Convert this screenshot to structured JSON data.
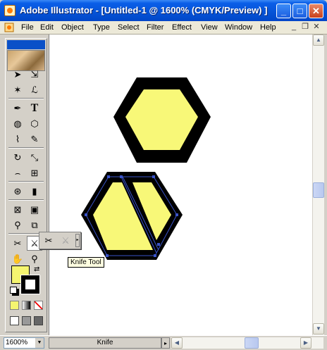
{
  "window": {
    "title": "Adobe Illustrator - [Untitled-1 @ 1600% (CMYK/Preview) ]",
    "minimize_label": "_",
    "maximize_label": "□",
    "close_label": "✕"
  },
  "menubar": {
    "items": [
      "File",
      "Edit",
      "Object",
      "Type",
      "Select",
      "Filter",
      "Effect",
      "View",
      "Window",
      "Help"
    ],
    "mdi_minimize": "_",
    "mdi_restore": "❐",
    "mdi_close": "✕"
  },
  "toolbox": {
    "tools": [
      {
        "name": "selection-tool-icon",
        "glyph": "➤"
      },
      {
        "name": "direct-selection-tool-icon",
        "glyph": "⇲"
      },
      {
        "name": "magic-wand-tool-icon",
        "glyph": "✶"
      },
      {
        "name": "lasso-tool-icon",
        "glyph": "ℒ"
      },
      {
        "name": "pen-tool-icon",
        "glyph": "✒"
      },
      {
        "name": "type-tool-icon",
        "glyph": "T"
      },
      {
        "name": "ellipse-tool-icon",
        "glyph": "◍"
      },
      {
        "name": "polygon-tool-icon",
        "glyph": "⬡"
      },
      {
        "name": "paintbrush-tool-icon",
        "glyph": "⌇"
      },
      {
        "name": "pencil-tool-icon",
        "glyph": "✎"
      },
      {
        "name": "rotate-tool-icon",
        "glyph": "↻"
      },
      {
        "name": "scale-tool-icon",
        "glyph": "⤡"
      },
      {
        "name": "warp-tool-icon",
        "glyph": "⌢"
      },
      {
        "name": "free-transform-tool-icon",
        "glyph": "⊞"
      },
      {
        "name": "symbol-sprayer-tool-icon",
        "glyph": "⊛"
      },
      {
        "name": "column-graph-tool-icon",
        "glyph": "▮"
      },
      {
        "name": "mesh-tool-icon",
        "glyph": "⊠"
      },
      {
        "name": "gradient-tool-icon",
        "glyph": "▣"
      },
      {
        "name": "eyedropper-tool-icon",
        "glyph": "⚲"
      },
      {
        "name": "blend-tool-icon",
        "glyph": "⧉"
      },
      {
        "name": "scissors-slice-tool-icon",
        "glyph": "✂"
      },
      {
        "name": "knife-tool-icon",
        "glyph": "⚔"
      },
      {
        "name": "hand-tool-icon",
        "glyph": "✋"
      },
      {
        "name": "zoom-tool-icon",
        "glyph": "⚲"
      }
    ],
    "fill_color": "#f5f570",
    "stroke_color": "#000000",
    "tooltip": "Knife Tool",
    "flyout_scissors": "✂",
    "flyout_knife": "⚔"
  },
  "canvas": {
    "background": "#ffffff",
    "shape_fill": "#f8f878",
    "shape_stroke": "#000000",
    "selection_color": "#3a53c8"
  },
  "statusbar": {
    "zoom": "1600%",
    "zoom_arrow": "▼",
    "tool_name": "Knife",
    "tool_arrow": "▸"
  },
  "scrollbars": {
    "up_arrow": "▲",
    "down_arrow": "▼",
    "left_arrow": "◀",
    "right_arrow": "▶"
  }
}
